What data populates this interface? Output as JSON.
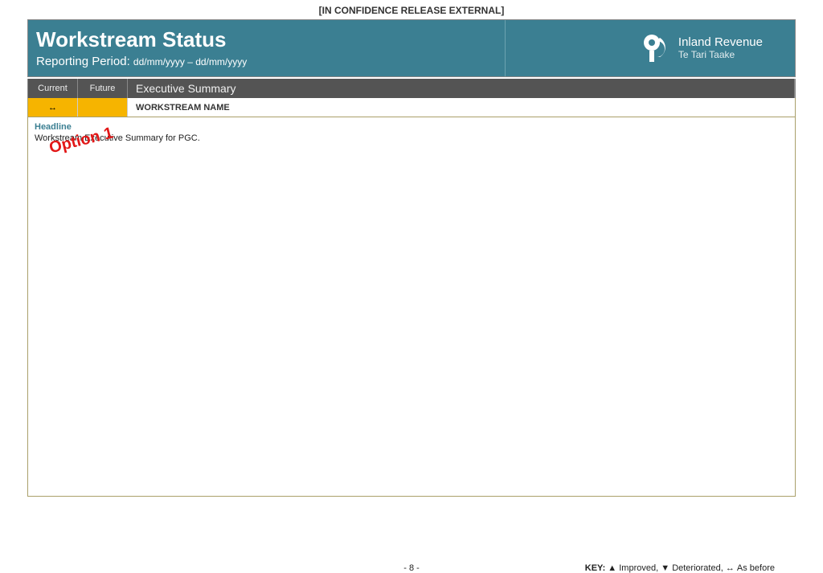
{
  "classification": "[IN CONFIDENCE RELEASE EXTERNAL]",
  "header": {
    "title": "Workstream Status",
    "period_label": "Reporting Period:",
    "period_value": "dd/mm/yyyy – dd/mm/yyyy",
    "brand_en": "Inland Revenue",
    "brand_mi": "Te Tari Taake"
  },
  "tabs": {
    "current": "Current",
    "future": "Future",
    "summary": "Executive Summary"
  },
  "row": {
    "symbol": "↔",
    "name": "WORKSTREAM NAME"
  },
  "body": {
    "headline": "Headline",
    "summary": "Workstream Executive Summary for PGC.",
    "watermark": "Option 1"
  },
  "footer": {
    "page": "- 8 -",
    "key_label": "KEY:",
    "improved": "Improved,",
    "deteriorated": "Deteriorated,",
    "asbefore": "As before"
  }
}
